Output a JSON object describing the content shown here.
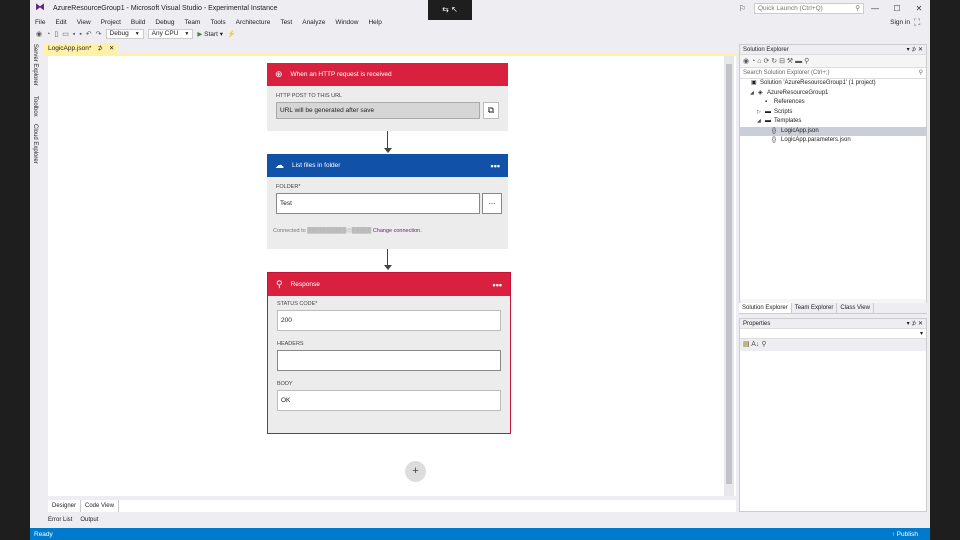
{
  "window": {
    "title": "AzureResourceGroup1 - Microsoft Visual Studio - Experimental Instance",
    "quick_launch_placeholder": "Quick Launch (Ctrl+Q)",
    "sign_in": "Sign in"
  },
  "menu": [
    "File",
    "Edit",
    "View",
    "Project",
    "Build",
    "Debug",
    "Team",
    "Tools",
    "Architecture",
    "Test",
    "Analyze",
    "Window",
    "Help"
  ],
  "toolbar": {
    "config": "Debug",
    "platform": "Any CPU",
    "start": "Start"
  },
  "side_tabs": [
    "Server Explorer",
    "Toolbox",
    "Cloud Explorer"
  ],
  "document_tab": {
    "label": "LogicApp.json*",
    "pin": "⊅",
    "close": "✕"
  },
  "designer": {
    "trigger": {
      "title": "When an HTTP request is received",
      "label": "HTTP POST TO THIS URL",
      "value": "URL will be generated after save",
      "color": "#d9213f"
    },
    "action": {
      "title": "List files in folder",
      "label": "FOLDER*",
      "value": "Test",
      "picker": "...",
      "connected_prefix": "Connected to",
      "connected_account": "██████████@█████",
      "change_link": "Change connection.",
      "color": "#1151a7"
    },
    "response": {
      "title": "Response",
      "status_label": "STATUS CODE*",
      "status_value": "200",
      "headers_label": "HEADERS",
      "headers_value": "",
      "body_label": "BODY",
      "body_value": "OK",
      "color": "#d9213f"
    },
    "more": "•••",
    "add": "+"
  },
  "editor_tabs": [
    "Designer",
    "Code View"
  ],
  "bottom_tabs": [
    "Error List",
    "Output"
  ],
  "status": {
    "left": "Ready",
    "right": "↑ Publish"
  },
  "solution_explorer": {
    "title": "Solution Explorer",
    "search_placeholder": "Search Solution Explorer (Ctrl+;)",
    "items": [
      {
        "label": "Solution 'AzureResourceGroup1' (1 project)",
        "indent": 0,
        "arrow": "",
        "icon": "▣"
      },
      {
        "label": "AzureResourceGroup1",
        "indent": 1,
        "arrow": "◢",
        "icon": "◈"
      },
      {
        "label": "References",
        "indent": 2,
        "arrow": "",
        "icon": "▪"
      },
      {
        "label": "Scripts",
        "indent": 2,
        "arrow": "▷",
        "icon": "▬"
      },
      {
        "label": "Templates",
        "indent": 2,
        "arrow": "◢",
        "icon": "▬"
      },
      {
        "label": "LogicApp.json",
        "indent": 3,
        "arrow": "",
        "icon": "{}",
        "selected": true
      },
      {
        "label": "LogicApp.parameters.json",
        "indent": 3,
        "arrow": "",
        "icon": "{}"
      }
    ],
    "tabs": [
      "Solution Explorer",
      "Team Explorer",
      "Class View"
    ]
  },
  "properties": {
    "title": "Properties"
  }
}
